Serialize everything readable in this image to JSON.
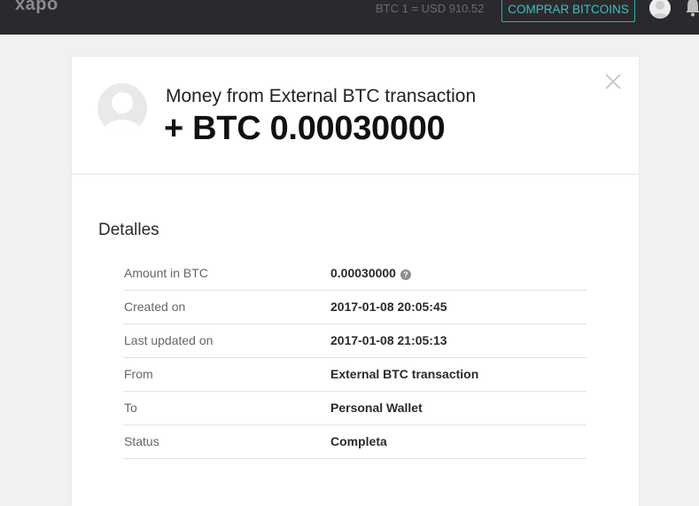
{
  "topbar": {
    "logo": "xapo",
    "rate": "BTC 1 = USD 910.52",
    "buy_button": "COMPRAR BITCOINS",
    "avatar_icon": "user-avatar-icon",
    "bell_icon": "bell-icon"
  },
  "transaction": {
    "title": "Money from External BTC transaction",
    "amount": "+ BTC 0.00030000",
    "avatar_icon": "user-avatar-icon",
    "close_icon": "close-icon"
  },
  "details": {
    "heading": "Detalles",
    "help_glyph": "?",
    "rows": [
      {
        "label": "Amount in BTC",
        "value": "0.00030000"
      },
      {
        "label": "Created on",
        "value": "2017-01-08 20:05:45"
      },
      {
        "label": "Last updated on",
        "value": "2017-01-08 21:05:13"
      },
      {
        "label": "From",
        "value": "External BTC transaction"
      },
      {
        "label": "To",
        "value": "Personal Wallet"
      },
      {
        "label": "Status",
        "value": "Completa"
      }
    ]
  },
  "colors": {
    "topbar_bg": "#2a2a2e",
    "accent": "#2bb3b0",
    "page_bg": "#f1f1f1"
  }
}
